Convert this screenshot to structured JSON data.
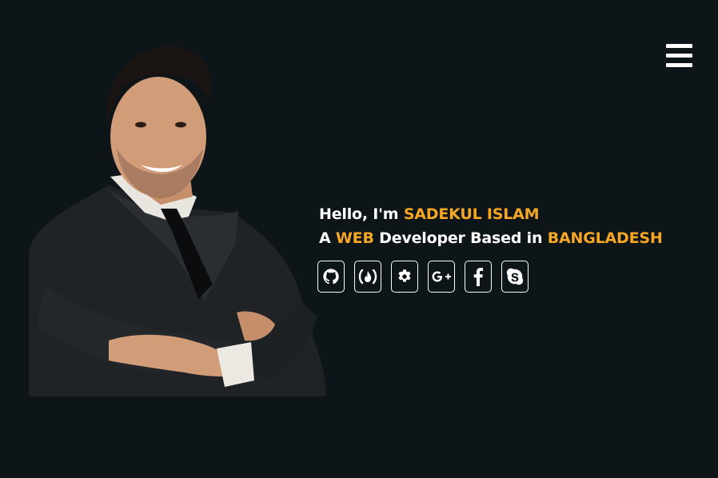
{
  "header": {
    "menu_icon": "hamburger-menu-icon"
  },
  "hero": {
    "portrait_alt": "portrait",
    "greeting_prefix": "Hello, I'm ",
    "name": "SADEKUL ISLAM",
    "tagline_prefix": "A ",
    "tagline_highlight": "WEB",
    "tagline_middle": " Developer Based in ",
    "location": "BANGLADESH"
  },
  "socials": [
    {
      "icon": "github-icon"
    },
    {
      "icon": "freecodecamp-icon"
    },
    {
      "icon": "gear-icon"
    },
    {
      "icon": "google-plus-icon"
    },
    {
      "icon": "facebook-icon"
    },
    {
      "icon": "skype-icon"
    }
  ],
  "colors": {
    "background": "#0e1518",
    "accent": "#f5a623",
    "text": "#ffffff"
  }
}
